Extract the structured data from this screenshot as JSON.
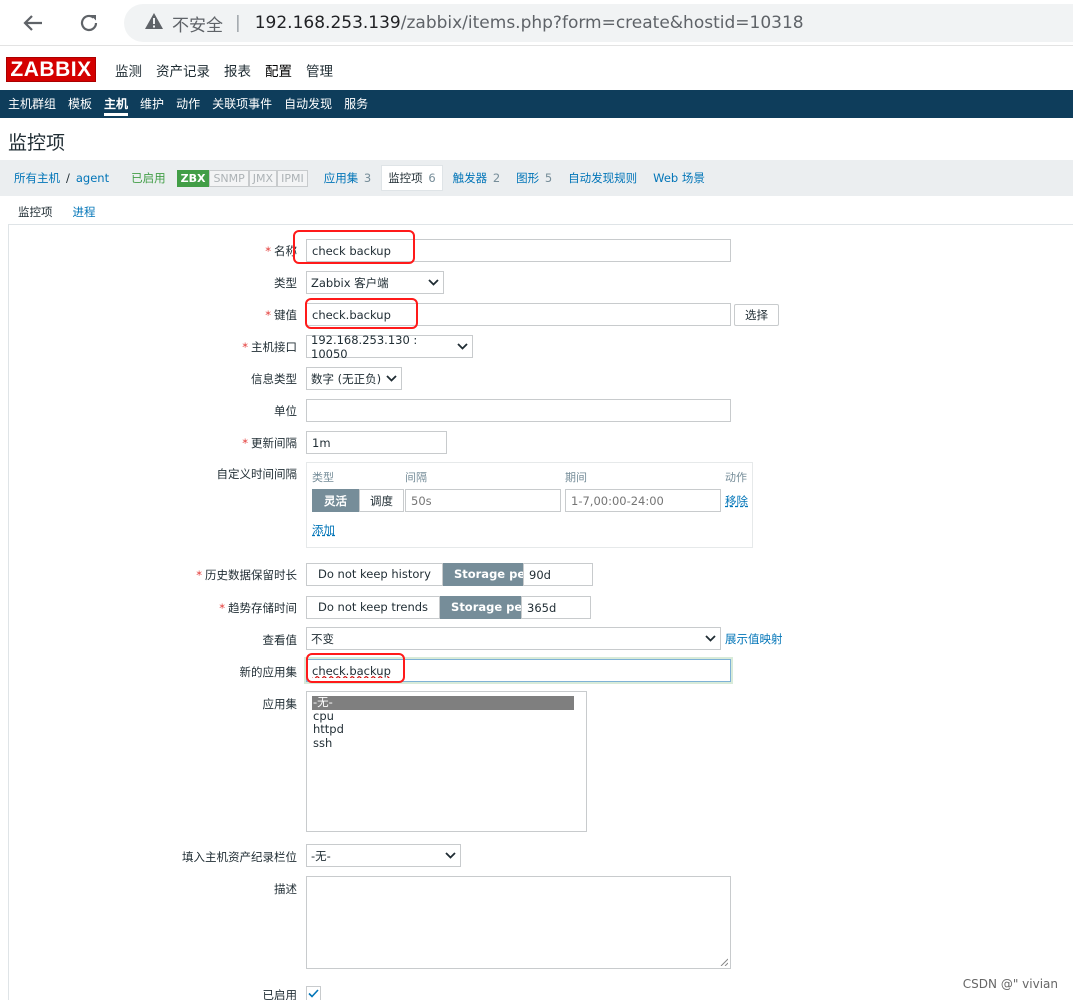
{
  "browser": {
    "insecure_label": "不安全",
    "url_host": "192.168.253.139",
    "url_path": "/zabbix/items.php?form=create&hostid=10318"
  },
  "header": {
    "logo": "ZABBIX",
    "menu": [
      "监测",
      "资产记录",
      "报表",
      "配置",
      "管理"
    ]
  },
  "subnav": [
    "主机群组",
    "模板",
    "主机",
    "维护",
    "动作",
    "关联项事件",
    "自动发现",
    "服务"
  ],
  "page_title": "监控项",
  "breadcrumb": {
    "all_hosts": "所有主机",
    "separator": "/",
    "host": "agent",
    "status": "已启用",
    "badges": [
      "ZBX",
      "SNMP",
      "JMX",
      "IPMI"
    ],
    "links": [
      {
        "label": "应用集",
        "count": "3"
      },
      {
        "label": "监控项",
        "count": "6"
      },
      {
        "label": "触发器",
        "count": "2"
      },
      {
        "label": "图形",
        "count": "5"
      },
      {
        "label": "自动发现规则",
        "count": ""
      },
      {
        "label": "Web 场景",
        "count": ""
      }
    ]
  },
  "tabs": [
    "监控项",
    "进程"
  ],
  "form": {
    "name": {
      "label": "名称",
      "value": "check backup"
    },
    "type": {
      "label": "类型",
      "value": "Zabbix 客户端"
    },
    "key": {
      "label": "键值",
      "value": "check.backup",
      "select_button": "选择"
    },
    "interface": {
      "label": "主机接口",
      "value": "192.168.253.130 : 10050"
    },
    "info_type": {
      "label": "信息类型",
      "value": "数字 (无正负)"
    },
    "units": {
      "label": "单位",
      "value": ""
    },
    "update_interval": {
      "label": "更新间隔",
      "value": "1m"
    },
    "custom_intervals": {
      "label": "自定义时间间隔",
      "col_type": "类型",
      "col_interval": "间隔",
      "col_period": "期间",
      "col_action": "动作",
      "opt_flexible": "灵活",
      "opt_scheduling": "调度",
      "interval_placeholder": "50s",
      "period_placeholder": "1-7,00:00-24:00",
      "remove": "移除",
      "add": "添加"
    },
    "history": {
      "label": "历史数据保留时长",
      "opt_no": "Do not keep history",
      "opt_storage": "Storage period",
      "value": "90d"
    },
    "trends": {
      "label": "趋势存储时间",
      "opt_no": "Do not keep trends",
      "opt_storage": "Storage period",
      "value": "365d"
    },
    "valuemap": {
      "label": "查看值",
      "value": "不变",
      "link": "展示值映射"
    },
    "new_application": {
      "label": "新的应用集",
      "value": "check.backup"
    },
    "applications": {
      "label": "应用集",
      "options": [
        "-无-",
        "cpu",
        "httpd",
        "ssh"
      ],
      "selected": "-无-"
    },
    "inventory": {
      "label": "填入主机资产纪录栏位",
      "value": "-无-"
    },
    "description": {
      "label": "描述",
      "value": ""
    },
    "enabled": {
      "label": "已启用"
    }
  },
  "watermark": "CSDN @\" vivian"
}
